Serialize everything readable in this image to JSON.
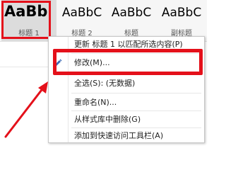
{
  "ribbon": {
    "styles": [
      {
        "sample": "AaBb",
        "name": "标题 1"
      },
      {
        "sample": "AaBbC",
        "name": "标题 2"
      },
      {
        "sample": "AaBbC",
        "name": "标题"
      },
      {
        "sample": "AaBbC",
        "name": "副标题"
      }
    ]
  },
  "menu": {
    "items": [
      {
        "label": "更新 标题 1 以匹配所选内容(P)",
        "icon": ""
      },
      {
        "label": "修改(M)...",
        "icon": "modify-style-icon"
      },
      {
        "label": "全选(S): (无数据)",
        "icon": ""
      },
      {
        "label": "重命名(N)...",
        "icon": ""
      },
      {
        "label": "从样式库中删除(G)",
        "icon": ""
      },
      {
        "label": "添加到快速访问工具栏(A)",
        "icon": ""
      }
    ]
  },
  "colors": {
    "highlight": "#e4101a",
    "icon_blue": "#3b6bb5"
  }
}
